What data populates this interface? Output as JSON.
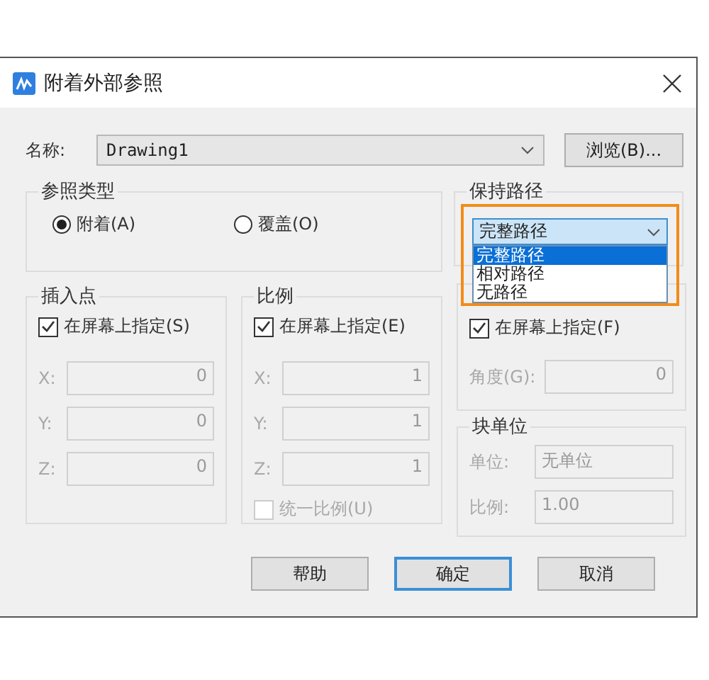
{
  "window": {
    "title": "附着外部参照"
  },
  "name": {
    "label": "名称:",
    "value": "Drawing1"
  },
  "browse_button": "浏览(B)...",
  "reference_type": {
    "title": "参照类型",
    "options": [
      {
        "label": "附着(A)",
        "selected": true
      },
      {
        "label": "覆盖(O)",
        "selected": false
      }
    ]
  },
  "path_type": {
    "title": "保持路径",
    "value": "完整路径",
    "expanded": true,
    "highlighted": true,
    "options": [
      {
        "label": "完整路径",
        "selected": true
      },
      {
        "label": "相对路径",
        "selected": false
      },
      {
        "label": "无路径",
        "selected": false
      }
    ]
  },
  "insertion_point": {
    "title": "插入点",
    "specify_on_screen": {
      "label": "在屏幕上指定(S)",
      "checked": true
    },
    "fields": [
      {
        "label": "X:",
        "value": "0",
        "disabled": true
      },
      {
        "label": "Y:",
        "value": "0",
        "disabled": true
      },
      {
        "label": "Z:",
        "value": "0",
        "disabled": true
      }
    ]
  },
  "scale": {
    "title": "比例",
    "specify_on_screen": {
      "label": "在屏幕上指定(E)",
      "checked": true
    },
    "fields": [
      {
        "label": "X:",
        "value": "1",
        "disabled": true
      },
      {
        "label": "Y:",
        "value": "1",
        "disabled": true
      },
      {
        "label": "Z:",
        "value": "1",
        "disabled": true
      }
    ],
    "uniform_scale": {
      "label": "统一比例(U)",
      "checked": false,
      "disabled": true
    }
  },
  "rotation": {
    "specify_on_screen": {
      "label": "在屏幕上指定(F)",
      "checked": true
    },
    "angle": {
      "label": "角度(G):",
      "value": "0",
      "disabled": true
    }
  },
  "block_unit": {
    "title": "块单位",
    "fields": [
      {
        "label": "单位:",
        "value": "无单位",
        "disabled": true
      },
      {
        "label": "比例:",
        "value": "1.00",
        "disabled": true
      }
    ]
  },
  "buttons": [
    {
      "label": "帮助",
      "default": false
    },
    {
      "label": "确定",
      "default": true
    },
    {
      "label": "取消",
      "default": false
    }
  ]
}
